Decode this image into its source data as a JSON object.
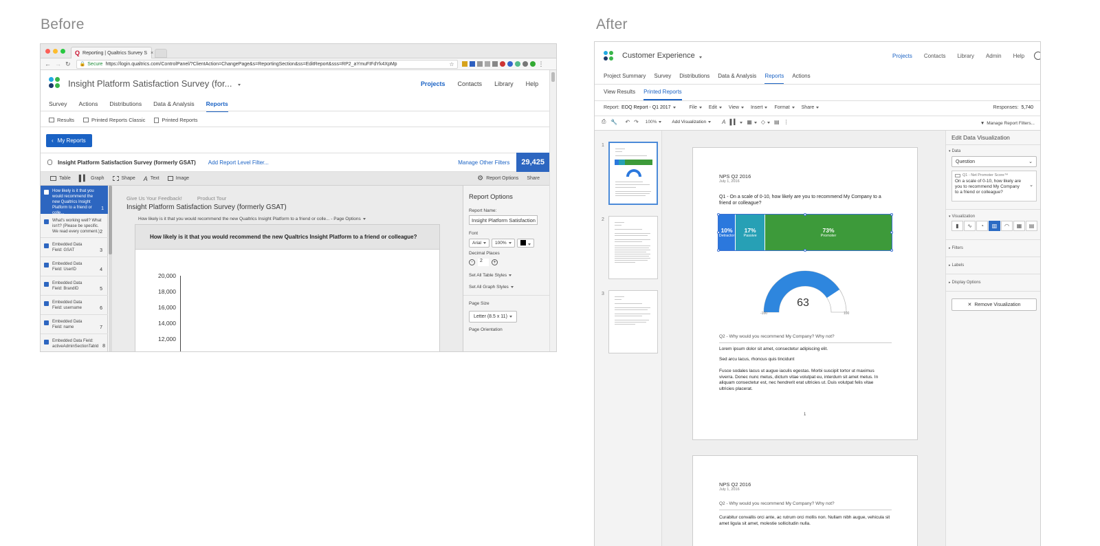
{
  "before_heading": "Before",
  "after_heading": "After",
  "before": {
    "browser": {
      "tab_title": "Reporting | Qualtrics Survey S",
      "secure_label": "Secure",
      "url": "https://login.qualtrics.com/ControlPanel/?ClientAction=ChangePage&s=ReportingSection&ss=EditReport&sss=RP2_aYmuFIFdYk4XpMp"
    },
    "app_title": "Insight Platform Satisfaction Survey (for...",
    "top_nav": [
      "Projects",
      "Contacts",
      "Library",
      "Help"
    ],
    "tabs": [
      "Survey",
      "Actions",
      "Distributions",
      "Data & Analysis",
      "Reports"
    ],
    "subtabs": [
      "Results",
      "Printed Reports Classic",
      "Printed Reports"
    ],
    "my_reports_label": "My Reports",
    "report_title": "Insight Platform Satisfaction Survey (formerly GSAT)",
    "add_filter_label": "Add Report Level Filter...",
    "manage_filters_label": "Manage Other Filters",
    "response_count": "29,425",
    "toolbar": [
      "Table",
      "Graph",
      "Shape",
      "Text",
      "Image"
    ],
    "report_options_label": "Report Options",
    "share_label": "Share",
    "sidebar_items": [
      {
        "text": "How likely is it that you would recommend the new Qualtrics Insight Platform to a friend or colle...",
        "num": "1"
      },
      {
        "text": "What's working well? What isn't? (Please be specific. We read every comment.)",
        "num": "2"
      },
      {
        "text": "Embedded Data Field: GSAT",
        "num": "3"
      },
      {
        "text": "Embedded Data Field: UserID",
        "num": "4"
      },
      {
        "text": "Embedded Data Field: BrandID",
        "num": "5"
      },
      {
        "text": "Embedded Data Field: username",
        "num": "6"
      },
      {
        "text": "Embedded Data Field: name",
        "num": "7"
      },
      {
        "text": "Embedded Data Field: activeAdminSectionTabId",
        "num": "8"
      }
    ],
    "canvas_links": [
      "Give Us Your Feedback!",
      "Product Tour"
    ],
    "canvas_title": "Insight Platform Satisfaction Survey (formerly GSAT)",
    "canvas_question_select": "How likely is it that you would recommend the new Qualtrics Insight Platform to a friend or colle... - Page Options",
    "canvas_question_heading": "How likely is it that you would recommend the new Qualtrics Insight Platform to a friend or colleague?",
    "chart_ticks": [
      "20,000",
      "18,000",
      "16,000",
      "14,000",
      "12,000"
    ],
    "options_panel": {
      "title": "Report Options",
      "report_name_label": "Report Name:",
      "report_name_value": "Insight Platform Satisfaction",
      "font_label": "Font",
      "font_value": "Arial",
      "size_value": "100%",
      "decimal_label": "Decimal Places",
      "decimal_value": "2",
      "table_styles": "Set All Table Styles",
      "graph_styles": "Set All Graph Styles",
      "page_size_label": "Page Size",
      "page_size_value": "Letter (8.5 x 11)",
      "page_orientation_label": "Page Orientation"
    }
  },
  "after": {
    "app_title": "Customer Experience",
    "top_nav": [
      "Projects",
      "Contacts",
      "Library",
      "Admin",
      "Help"
    ],
    "tabs": [
      "Project Summary",
      "Survey",
      "Distributions",
      "Data & Analysis",
      "Reports",
      "Actions"
    ],
    "subtabs": [
      "View Results",
      "Printed Reports"
    ],
    "report_label": "Report:",
    "report_value": "EOQ Report - Q1 2017",
    "menus": [
      "File",
      "Edit",
      "View",
      "Insert",
      "Format",
      "Share"
    ],
    "responses_label": "Responses:",
    "responses_value": "5,740",
    "zoom": "100%",
    "add_viz_label": "Add Visualization",
    "manage_filters_label": "Manage Report Filters...",
    "thumb_numbers": [
      "1",
      "2",
      "3"
    ],
    "page1": {
      "title": "NPS Q2 2016",
      "date": "July 1, 2016",
      "q1": "Q1 - On a scale of 0-10, how likely are you to recommend My Company to a friend or colleague?",
      "segments": [
        {
          "pct": "10%",
          "label": "Detractor",
          "value": 10,
          "color": "#2b78dd"
        },
        {
          "pct": "17%",
          "label": "Passive",
          "value": 17,
          "color": "#27a0b5"
        },
        {
          "pct": "73%",
          "label": "Promoter",
          "value": 73,
          "color": "#3d9a3a"
        }
      ],
      "gauge_value": "63",
      "gauge_min": "-100",
      "gauge_max": "100",
      "q2": "Q2 - Why would you recommend My Company? Why not?",
      "p1": "Lorem ipsum dolor sit amet, consectetur adipiscing elit.",
      "p2": "Sed arcu lacus, rhoncus quis tincidunt",
      "p3": "Fusce sodales lacus ut augue iaculis egestas. Morbi suscipit tortor ut maximus viverra. Donec nunc metus, dictum vitae volutpat eu, interdum sit amet metus. In aliquam consectetur est, nec hendrerit erat ultricies ut. Duis volutpat felis vitae ultricies placerat.",
      "page_number": "1"
    },
    "page2": {
      "title": "NPS Q2 2016",
      "date": "July 1, 2016",
      "q2": "Q2 - Why would you recommend My Company? Why not?",
      "p1": "Curabitur convallis orci ante, ac rutrum orci mollis non. Nullam nibh augue, vehicula sit amet ligula sit amet, molestie sollicitudin nulla."
    },
    "panel": {
      "title": "Edit Data Visualization",
      "data_label": "Data",
      "data_select": "Question",
      "question_id": "Q1 - Net Promoter Score™",
      "question_text": "On a scale of 0-10, how likely are you to recommend My Company to a friend or colleague?",
      "viz_label": "Visualization",
      "filters_label": "Filters",
      "labels_label": "Labels",
      "display_label": "Display Options",
      "remove_label": "Remove Visualization"
    }
  }
}
